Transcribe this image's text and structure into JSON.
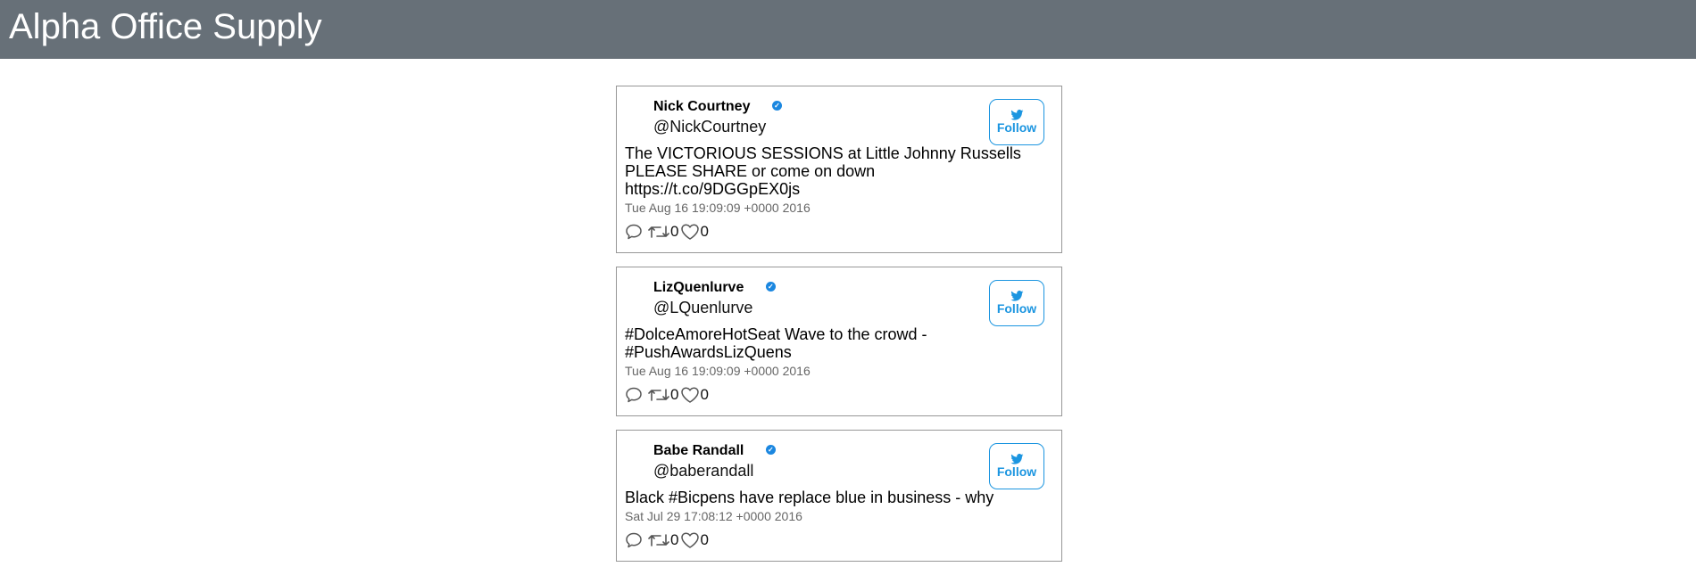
{
  "app": {
    "title": "Alpha Office Supply",
    "header_color": "#677078",
    "accent_color": "#1b95e0"
  },
  "feed": {
    "tweets": [
      {
        "name": "Nick Courtney",
        "handle": "@NickCourtney",
        "text": "The VICTORIOUS SESSIONS at Little Johnny Russells PLEASE SHARE or come on down https://t.co/9DGGpEX0js",
        "date": "Tue Aug 16 19:09:09 +0000 2016",
        "retweets": "0",
        "likes": "0",
        "follow_label": "Follow",
        "badge_icon": "verified-badge-icon"
      },
      {
        "name": "LizQuenlurve",
        "handle": "@LQuenlurve",
        "text": "#DolceAmoreHotSeat Wave to the crowd - #PushAwardsLizQuens",
        "date": "Tue Aug 16 19:09:09 +0000 2016",
        "retweets": "0",
        "likes": "0",
        "follow_label": "Follow",
        "badge_icon": "verified-badge-icon"
      },
      {
        "name": "Babe Randall",
        "handle": "@baberandall",
        "text": "Black #Bicpens have replace blue in business - why",
        "date": "Sat Jul 29 17:08:12 +0000 2016",
        "retweets": "0",
        "likes": "0",
        "follow_label": "Follow",
        "badge_icon": "verified-badge-icon"
      }
    ]
  }
}
